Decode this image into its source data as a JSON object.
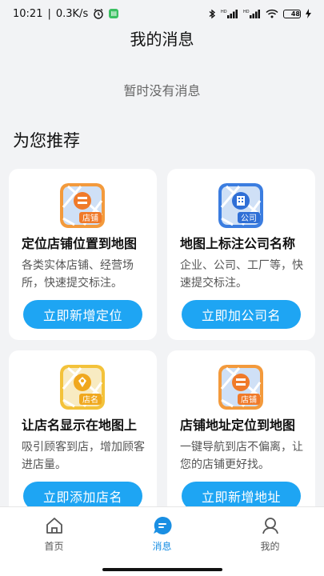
{
  "status_bar": {
    "time": "10:21",
    "speed": "0.3K/s",
    "battery": "48"
  },
  "header": {
    "title": "我的消息"
  },
  "empty": {
    "text": "暂时没有消息"
  },
  "section": {
    "title": "为您推荐"
  },
  "cards": [
    {
      "icon_label": "店铺",
      "icon": "store-map-icon",
      "title": "定位店铺位置到地图",
      "desc": "各类实体店铺、经营场所，快速提交标注。",
      "button": "立即新增定位"
    },
    {
      "icon_label": "公司",
      "icon": "company-map-icon",
      "title": "地图上标注公司名称",
      "desc": "企业、公司、工厂等，快速提交标注。",
      "button": "立即加公司名"
    },
    {
      "icon_label": "店名",
      "icon": "shop-name-tag-icon",
      "title": "让店名显示在地图上",
      "desc": "吸引顾客到店，增加顾客进店量。",
      "button": "立即添加店名"
    },
    {
      "icon_label": "店铺",
      "icon": "store-address-map-icon",
      "title": "店铺地址定位到地图",
      "desc": "一键导航到店不偏离，让您的店铺更好找。",
      "button": "立即新增地址"
    }
  ],
  "nav": {
    "home": "首页",
    "messages": "消息",
    "profile": "我的"
  },
  "colors": {
    "accent": "#1ea5f3",
    "nav_active": "#1a8fe3",
    "card_orange": "#f39a3c",
    "card_blue": "#3b7de0",
    "card_yellow": "#f3c23a"
  }
}
